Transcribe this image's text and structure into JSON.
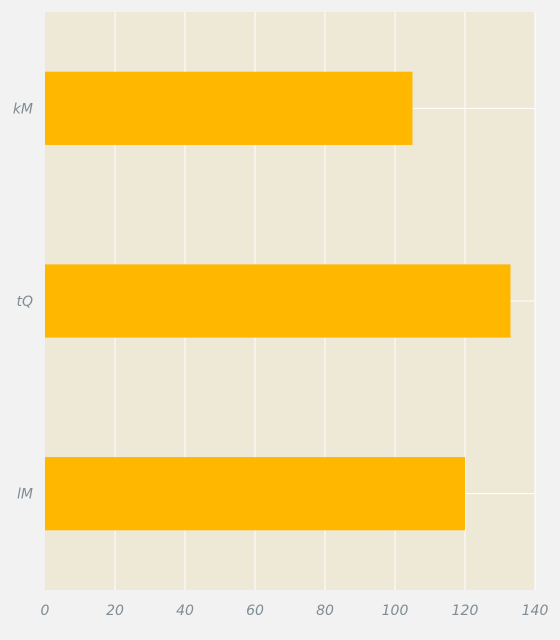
{
  "chart_data": {
    "type": "bar",
    "orientation": "horizontal",
    "title": "",
    "xlabel": "",
    "ylabel": "",
    "categories": [
      "kM",
      "tQ",
      "lM"
    ],
    "values": [
      105,
      133,
      120
    ],
    "xlim": [
      0,
      140
    ],
    "xticks": [
      0,
      20,
      40,
      60,
      80,
      100,
      120,
      140
    ],
    "grid": true,
    "legend": "none",
    "colors": {
      "background": "#f2f2f2",
      "plot_area": "#eee8d6",
      "bar": "#ffb700",
      "grid": "#ffffff",
      "text": "#7f8c94"
    }
  }
}
